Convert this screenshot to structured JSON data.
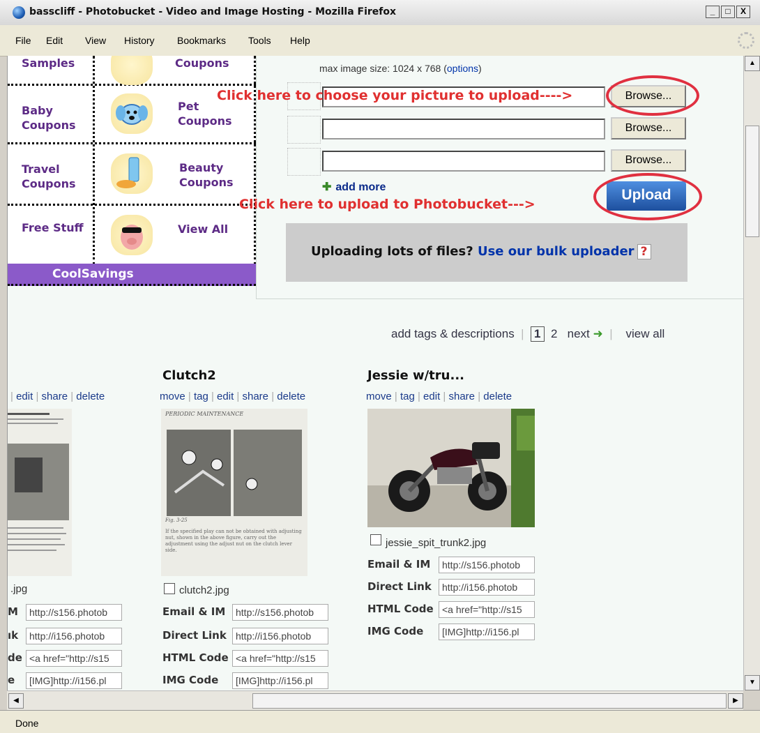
{
  "window": {
    "title": "basscliff - Photobucket - Video and Image Hosting - Mozilla Firefox",
    "min": "_",
    "max": "□",
    "close": "X"
  },
  "menu": [
    "File",
    "Edit",
    "View",
    "History",
    "Bookmarks",
    "Tools",
    "Help"
  ],
  "ad": {
    "cells": [
      [
        "Samples",
        "Coupons"
      ],
      [
        "Baby Coupons",
        "Pet Coupons"
      ],
      [
        "Travel Coupons",
        "Beauty Coupons"
      ],
      [
        "Free Stuff",
        "View All"
      ]
    ],
    "brand": "CoolSavings"
  },
  "upload": {
    "max_size_prefix": "max image size: 1024 x 768 (",
    "options_link": "options",
    "max_size_suffix": ")",
    "browse_label": "Browse...",
    "add_more": "add more",
    "upload_label": "Upload",
    "annotation_choose": "Click here to choose your picture to upload---->",
    "annotation_upload": "Click here to upload to Photobucket--->",
    "bulk_text": "Uploading lots of files?",
    "bulk_link": "Use our bulk uploader",
    "bulk_help": "?"
  },
  "pager": {
    "add_tags": "add tags & descriptions",
    "page1": "1",
    "page2": "2",
    "next": "next",
    "view_all": "view all"
  },
  "photos": {
    "left": {
      "actions": [
        "edit",
        "share",
        "delete"
      ],
      "filename": ".jpg",
      "labels": [
        "M",
        "ık",
        "de",
        "e"
      ],
      "codes": [
        "http://s156.photob",
        "http://i156.photob",
        "<a href=\"http://s15",
        "[IMG]http://i156.pl"
      ]
    },
    "clutch": {
      "title": "Clutch2",
      "actions": [
        "move",
        "tag",
        "edit",
        "share",
        "delete"
      ],
      "filename": "clutch2.jpg",
      "labels": [
        "Email & IM",
        "Direct Link",
        "HTML Code",
        "IMG Code"
      ],
      "codes": [
        "http://s156.photob",
        "http://i156.photob",
        "<a href=\"http://s15",
        "[IMG]http://i156.pl"
      ],
      "page_header": "PERIODIC MAINTENANCE",
      "fig": "Fig. 3-25",
      "caption": "If the specified play can not be obtained with adjusting nut, shown in the above figure, carry out the adjustment using the adjust nut on the clutch lever side."
    },
    "jessie": {
      "title": "Jessie w/tru...",
      "actions": [
        "move",
        "tag",
        "edit",
        "share",
        "delete"
      ],
      "filename": "jessie_spit_trunk2.jpg",
      "labels": [
        "Email & IM",
        "Direct Link",
        "HTML Code",
        "IMG Code"
      ],
      "codes": [
        "http://s156.photob",
        "http://i156.photob",
        "<a href=\"http://s15",
        "[IMG]http://i156.pl"
      ]
    }
  },
  "status": "Done"
}
